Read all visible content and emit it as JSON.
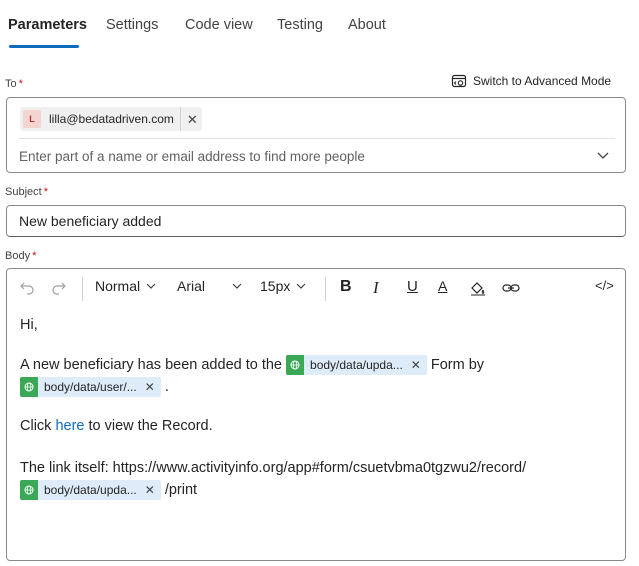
{
  "tabs": [
    {
      "label": "Parameters",
      "active": true
    },
    {
      "label": "Settings",
      "active": false
    },
    {
      "label": "Code view",
      "active": false
    },
    {
      "label": "Testing",
      "active": false
    },
    {
      "label": "About",
      "active": false
    }
  ],
  "to": {
    "label": "To",
    "required_mark": "*",
    "advanced_mode_label": "Switch to Advanced Mode",
    "recipient": {
      "initial": "L",
      "email": "lilla@bedatadriven.com"
    },
    "placeholder": "Enter part of a name or email address to find more people"
  },
  "subject": {
    "label": "Subject",
    "required_mark": "*",
    "value": "New beneficiary added"
  },
  "body": {
    "label": "Body",
    "required_mark": "*",
    "toolbar": {
      "style": "Normal",
      "font": "Arial",
      "size": "15px",
      "bold": "B",
      "italic": "I",
      "underline": "U",
      "font_color": "A",
      "code_view": "</>"
    },
    "content": {
      "greeting": "Hi,",
      "line1_before": "A new beneficiary has been added to the",
      "token1": "body/data/upda...",
      "line1_after": "Form by",
      "token2": "body/data/user/...",
      "line2_after": ".",
      "line3_before": "Click",
      "line3_link": "here",
      "line3_after": "to view the Record.",
      "line4": "The link itself: https://www.activityinfo.org/app#form/csuetvbma0tgzwu2/record/",
      "token3": "body/data/upda...",
      "line5_after": "/print"
    }
  },
  "colors": {
    "accent": "#0f6cbd",
    "required": "#c50f1f",
    "token_bg": "#deecf9",
    "token_icon": "#3aa856"
  }
}
